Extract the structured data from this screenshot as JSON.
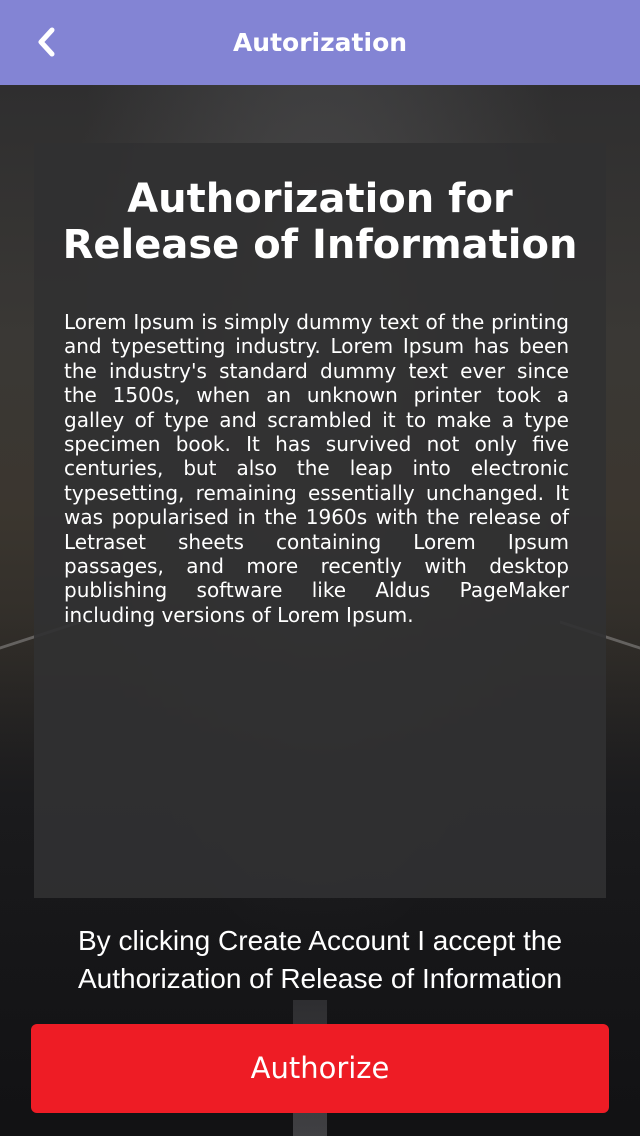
{
  "header": {
    "title": "Autorization",
    "back_icon": "chevron-left-icon",
    "color": "#8384d4"
  },
  "panel": {
    "title_line1": "Authorization for",
    "title_line2": "Release of Information",
    "body": "Lorem Ipsum is simply dummy text of the printing and typesetting industry. Lorem Ipsum has been the industry's standard dummy text ever since the 1500s, when an unknown printer took a galley of type and scrambled it to make a type specimen book. It has survived not only five centuries, but also the leap into electronic typeset­ting, remaining essentially unchanged. It was popularised in the 1960s with the release of Letraset sheets containing Lorem Ipsum passages, and more recently with desktop publishing software like Aldus PageMaker including versions of Lorem Ipsum."
  },
  "consent": {
    "line1": "By clicking Create Account I accept the",
    "line2": "Authorization of Release of Information"
  },
  "actions": {
    "authorize_label": "Authorize",
    "authorize_color": "#ee1c25"
  }
}
